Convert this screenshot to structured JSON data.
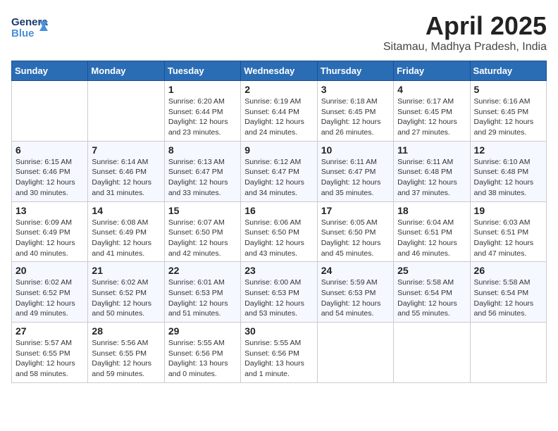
{
  "header": {
    "logo_line1": "General",
    "logo_line2": "Blue",
    "month_year": "April 2025",
    "location": "Sitamau, Madhya Pradesh, India"
  },
  "weekdays": [
    "Sunday",
    "Monday",
    "Tuesday",
    "Wednesday",
    "Thursday",
    "Friday",
    "Saturday"
  ],
  "weeks": [
    [
      {
        "day": "",
        "info": ""
      },
      {
        "day": "",
        "info": ""
      },
      {
        "day": "1",
        "info": "Sunrise: 6:20 AM\nSunset: 6:44 PM\nDaylight: 12 hours and 23 minutes."
      },
      {
        "day": "2",
        "info": "Sunrise: 6:19 AM\nSunset: 6:44 PM\nDaylight: 12 hours and 24 minutes."
      },
      {
        "day": "3",
        "info": "Sunrise: 6:18 AM\nSunset: 6:45 PM\nDaylight: 12 hours and 26 minutes."
      },
      {
        "day": "4",
        "info": "Sunrise: 6:17 AM\nSunset: 6:45 PM\nDaylight: 12 hours and 27 minutes."
      },
      {
        "day": "5",
        "info": "Sunrise: 6:16 AM\nSunset: 6:45 PM\nDaylight: 12 hours and 29 minutes."
      }
    ],
    [
      {
        "day": "6",
        "info": "Sunrise: 6:15 AM\nSunset: 6:46 PM\nDaylight: 12 hours and 30 minutes."
      },
      {
        "day": "7",
        "info": "Sunrise: 6:14 AM\nSunset: 6:46 PM\nDaylight: 12 hours and 31 minutes."
      },
      {
        "day": "8",
        "info": "Sunrise: 6:13 AM\nSunset: 6:47 PM\nDaylight: 12 hours and 33 minutes."
      },
      {
        "day": "9",
        "info": "Sunrise: 6:12 AM\nSunset: 6:47 PM\nDaylight: 12 hours and 34 minutes."
      },
      {
        "day": "10",
        "info": "Sunrise: 6:11 AM\nSunset: 6:47 PM\nDaylight: 12 hours and 35 minutes."
      },
      {
        "day": "11",
        "info": "Sunrise: 6:11 AM\nSunset: 6:48 PM\nDaylight: 12 hours and 37 minutes."
      },
      {
        "day": "12",
        "info": "Sunrise: 6:10 AM\nSunset: 6:48 PM\nDaylight: 12 hours and 38 minutes."
      }
    ],
    [
      {
        "day": "13",
        "info": "Sunrise: 6:09 AM\nSunset: 6:49 PM\nDaylight: 12 hours and 40 minutes."
      },
      {
        "day": "14",
        "info": "Sunrise: 6:08 AM\nSunset: 6:49 PM\nDaylight: 12 hours and 41 minutes."
      },
      {
        "day": "15",
        "info": "Sunrise: 6:07 AM\nSunset: 6:50 PM\nDaylight: 12 hours and 42 minutes."
      },
      {
        "day": "16",
        "info": "Sunrise: 6:06 AM\nSunset: 6:50 PM\nDaylight: 12 hours and 43 minutes."
      },
      {
        "day": "17",
        "info": "Sunrise: 6:05 AM\nSunset: 6:50 PM\nDaylight: 12 hours and 45 minutes."
      },
      {
        "day": "18",
        "info": "Sunrise: 6:04 AM\nSunset: 6:51 PM\nDaylight: 12 hours and 46 minutes."
      },
      {
        "day": "19",
        "info": "Sunrise: 6:03 AM\nSunset: 6:51 PM\nDaylight: 12 hours and 47 minutes."
      }
    ],
    [
      {
        "day": "20",
        "info": "Sunrise: 6:02 AM\nSunset: 6:52 PM\nDaylight: 12 hours and 49 minutes."
      },
      {
        "day": "21",
        "info": "Sunrise: 6:02 AM\nSunset: 6:52 PM\nDaylight: 12 hours and 50 minutes."
      },
      {
        "day": "22",
        "info": "Sunrise: 6:01 AM\nSunset: 6:53 PM\nDaylight: 12 hours and 51 minutes."
      },
      {
        "day": "23",
        "info": "Sunrise: 6:00 AM\nSunset: 6:53 PM\nDaylight: 12 hours and 53 minutes."
      },
      {
        "day": "24",
        "info": "Sunrise: 5:59 AM\nSunset: 6:53 PM\nDaylight: 12 hours and 54 minutes."
      },
      {
        "day": "25",
        "info": "Sunrise: 5:58 AM\nSunset: 6:54 PM\nDaylight: 12 hours and 55 minutes."
      },
      {
        "day": "26",
        "info": "Sunrise: 5:58 AM\nSunset: 6:54 PM\nDaylight: 12 hours and 56 minutes."
      }
    ],
    [
      {
        "day": "27",
        "info": "Sunrise: 5:57 AM\nSunset: 6:55 PM\nDaylight: 12 hours and 58 minutes."
      },
      {
        "day": "28",
        "info": "Sunrise: 5:56 AM\nSunset: 6:55 PM\nDaylight: 12 hours and 59 minutes."
      },
      {
        "day": "29",
        "info": "Sunrise: 5:55 AM\nSunset: 6:56 PM\nDaylight: 13 hours and 0 minutes."
      },
      {
        "day": "30",
        "info": "Sunrise: 5:55 AM\nSunset: 6:56 PM\nDaylight: 13 hours and 1 minute."
      },
      {
        "day": "",
        "info": ""
      },
      {
        "day": "",
        "info": ""
      },
      {
        "day": "",
        "info": ""
      }
    ]
  ]
}
